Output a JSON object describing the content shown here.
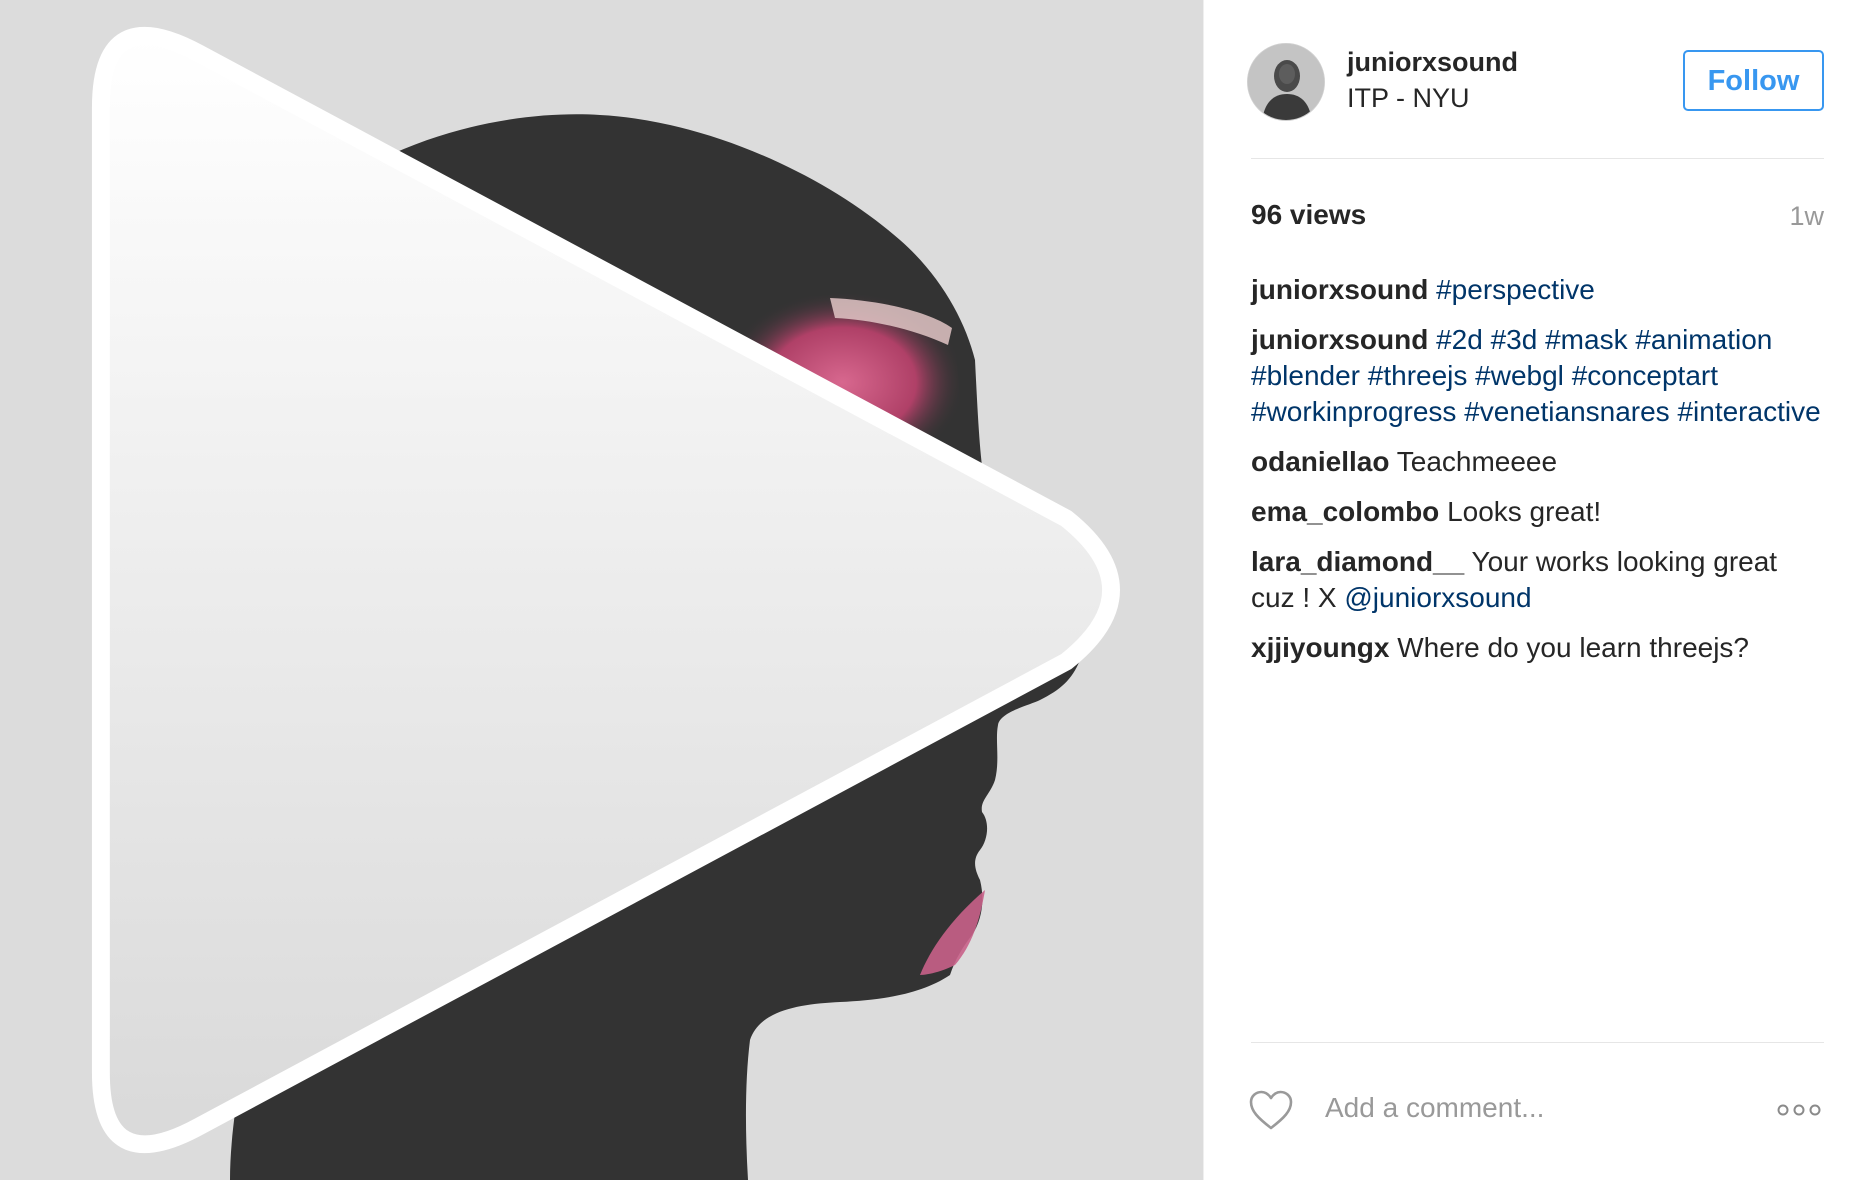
{
  "media": {
    "type": "video",
    "play_icon": "play-icon",
    "colors": {
      "background": "#dcdcdc",
      "silhouette": "#333333",
      "accent": "#d9567a"
    }
  },
  "header": {
    "avatar_icon": "avatar-photo",
    "username": "juniorxsound",
    "location": "ITP - NYU",
    "follow_label": "Follow"
  },
  "stats": {
    "views": "96 views",
    "timestamp": "1w"
  },
  "comments": [
    {
      "author": "juniorxsound",
      "segments": [
        {
          "text": "#perspective",
          "tag": true
        }
      ]
    },
    {
      "author": "juniorxsound",
      "segments": [
        {
          "text": "#2d",
          "tag": true
        },
        {
          "text": " ",
          "tag": false
        },
        {
          "text": "#3d",
          "tag": true
        },
        {
          "text": " ",
          "tag": false
        },
        {
          "text": "#mask",
          "tag": true
        },
        {
          "text": " ",
          "tag": false
        },
        {
          "text": "#animation",
          "tag": true
        },
        {
          "text": " ",
          "tag": false
        },
        {
          "text": "#blender",
          "tag": true
        },
        {
          "text": " ",
          "tag": false
        },
        {
          "text": "#threejs",
          "tag": true
        },
        {
          "text": " ",
          "tag": false
        },
        {
          "text": "#webgl",
          "tag": true
        },
        {
          "text": " ",
          "tag": false
        },
        {
          "text": "#conceptart",
          "tag": true
        },
        {
          "text": " ",
          "tag": false
        },
        {
          "text": "#workinprogress",
          "tag": true
        },
        {
          "text": " ",
          "tag": false
        },
        {
          "text": "#venetiansnares",
          "tag": true
        },
        {
          "text": " ",
          "tag": false
        },
        {
          "text": "#interactive",
          "tag": true
        }
      ]
    },
    {
      "author": "odaniellao",
      "segments": [
        {
          "text": "Teachmeeee",
          "tag": false
        }
      ]
    },
    {
      "author": "ema_colombo",
      "segments": [
        {
          "text": "Looks great!",
          "tag": false
        }
      ]
    },
    {
      "author": "lara_diamond__",
      "segments": [
        {
          "text": "Your works looking great cuz ! X ",
          "tag": false
        },
        {
          "text": "@juniorxsound",
          "tag": true
        }
      ]
    },
    {
      "author": "xjjiyoungx",
      "segments": [
        {
          "text": "Where do you learn threejs?",
          "tag": false
        }
      ]
    }
  ],
  "footer": {
    "like_icon": "heart-outline-icon",
    "comment_placeholder": "Add a comment...",
    "more_icon": "ellipsis-icon"
  },
  "colors": {
    "link": "#003569",
    "follow": "#3897f0",
    "text": "#262626",
    "muted": "#999999",
    "divider": "#e6e6e6"
  }
}
